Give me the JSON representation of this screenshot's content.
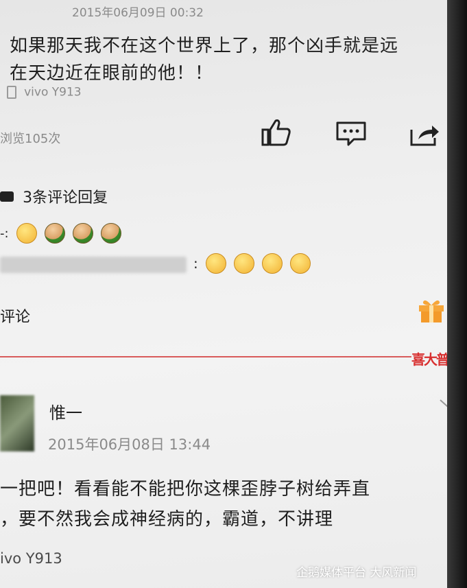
{
  "post": {
    "timestamp": "2015年06月09日 00:32",
    "content_line1": "如果那天我不在这个世界上了，那个凶手就是远",
    "content_line2": "在天边近在眼前的他！！",
    "device": "vivo Y913",
    "views": "浏览105次",
    "comments_header": "3条评论回复",
    "reply1_prefix": "-:",
    "reply2_suffix": ":",
    "comment_label": "评论",
    "banner": "喜大普"
  },
  "icons": {
    "like": "thumbs-up-icon",
    "comment": "comment-icon",
    "share": "share-icon",
    "comments_header": "comment-bubble-icon",
    "gift": "gift-icon",
    "device": "phone-icon",
    "chevron": "chevron-down-icon"
  },
  "second_post": {
    "username": "惟一",
    "timestamp": "2015年06月08日 13:44",
    "content_line1": "一把吧！看看能不能把你这棵歪脖子树给弄直",
    "content_line2": "，要不然我会成神经病的，霸道，不讲理",
    "device": "ivo Y913"
  },
  "watermark": "企鹅媒体平台 大风新闻",
  "colors": {
    "divider": "#d85a5a",
    "text": "#1f1f1f",
    "gift": "#f39a2b"
  }
}
